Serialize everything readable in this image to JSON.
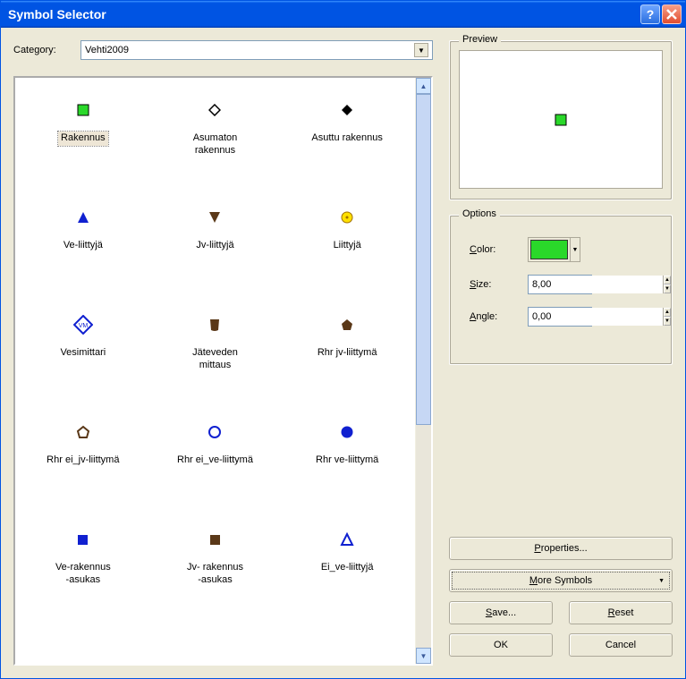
{
  "window": {
    "title": "Symbol Selector"
  },
  "category": {
    "label": "Category:",
    "value": "Vehti2009"
  },
  "symbols": [
    {
      "label": "Rakennus",
      "selected": true
    },
    {
      "label": "Asumaton\nrakennus"
    },
    {
      "label": "Asuttu rakennus"
    },
    {
      "label": "Ve-liittyjä"
    },
    {
      "label": "Jv-liittyjä"
    },
    {
      "label": "Liittyjä"
    },
    {
      "label": "Vesimittari"
    },
    {
      "label": "Jäteveden\nmittaus"
    },
    {
      "label": "Rhr jv-liittymä"
    },
    {
      "label": "Rhr ei_jv-liittymä"
    },
    {
      "label": "Rhr ei_ve-liittymä"
    },
    {
      "label": "Rhr ve-liittymä"
    },
    {
      "label": "Ve-rakennus\n-asukas"
    },
    {
      "label": "Jv- rakennus\n-asukas"
    },
    {
      "label": "Ei_ve-liittyjä"
    }
  ],
  "preview": {
    "legend": "Preview",
    "color": "#2ad82a"
  },
  "options": {
    "legend": "Options",
    "color_label": "Color:",
    "color": "#2ad82a",
    "size_label": "Size:",
    "size": "8,00",
    "angle_label": "Angle:",
    "angle": "0,00"
  },
  "buttons": {
    "properties": "Properties...",
    "more": "More Symbols",
    "save": "Save...",
    "reset": "Reset",
    "ok": "OK",
    "cancel": "Cancel"
  }
}
